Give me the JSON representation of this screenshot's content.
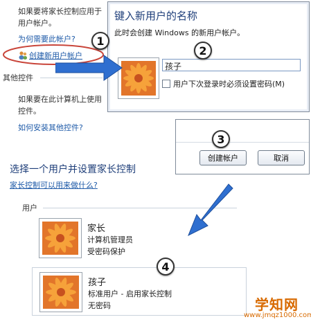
{
  "left_bg": {
    "line1": "如果要将家长控制应用于",
    "line2": "用户帐户。",
    "why_need_link": "为何需要此帐户?",
    "create_account_link": "创建新用户帐户",
    "other_controls_heading": "其他控件",
    "other_line1": "如果要在此计算机上使用",
    "other_line2": "控件。",
    "install_controls_link": "如何安装其他控件?"
  },
  "dialog": {
    "title": "键入新用户的名称",
    "subtitle": "此时会创建 Windows 的新用户帐户。",
    "name_value": "孩子",
    "checkbox_label": "用户下次登录时必须设置密码(M)"
  },
  "buttons_panel": {
    "create_button": "创建帐户",
    "cancel_button": "取消"
  },
  "section": {
    "title": "选择一个用户并设置家长控制",
    "help_link": "家长控制可以用来做什么?",
    "users_label": "用户"
  },
  "users": [
    {
      "name": "家长",
      "role": "计算机管理员",
      "status": "受密码保护"
    },
    {
      "name": "孩子",
      "role": "标准用户 - 启用家长控制",
      "status": "无密码"
    }
  ],
  "badges": {
    "b1": "1",
    "b2": "2",
    "b3": "3",
    "b4": "4"
  },
  "watermark": {
    "logo": "学知网",
    "url": "www.jmqz1000.com"
  },
  "colors": {
    "accent_link": "#1e5aa8",
    "arrow": "#2f6fd0",
    "highlight_ring": "#c9453a",
    "watermark": "#d86a00"
  }
}
